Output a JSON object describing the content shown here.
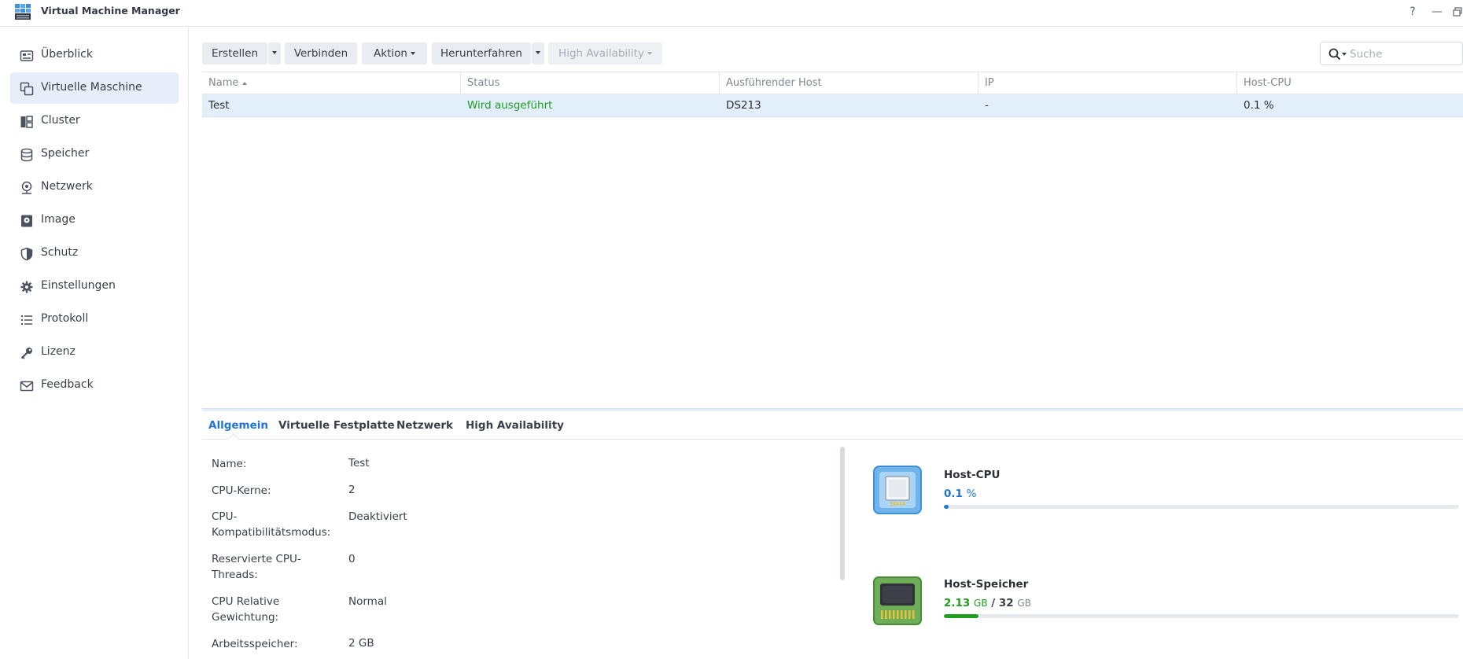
{
  "window": {
    "title": "Virtual Machine Manager",
    "help_label": "?",
    "minimize_label": "—"
  },
  "sidebar": {
    "items": [
      {
        "label": "Überblick",
        "icon": "overview-icon"
      },
      {
        "label": "Virtuelle Maschine",
        "icon": "virtual-machine-icon",
        "active": true
      },
      {
        "label": "Cluster",
        "icon": "cluster-icon"
      },
      {
        "label": "Speicher",
        "icon": "storage-icon"
      },
      {
        "label": "Netzwerk",
        "icon": "network-icon"
      },
      {
        "label": "Image",
        "icon": "image-icon"
      },
      {
        "label": "Schutz",
        "icon": "shield-icon"
      },
      {
        "label": "Einstellungen",
        "icon": "gear-icon"
      },
      {
        "label": "Protokoll",
        "icon": "log-list-icon"
      },
      {
        "label": "Lizenz",
        "icon": "key-icon"
      },
      {
        "label": "Feedback",
        "icon": "mail-icon"
      }
    ]
  },
  "toolbar": {
    "create_label": "Erstellen",
    "connect_label": "Verbinden",
    "action_label": "Aktion",
    "shutdown_label": "Herunterfahren",
    "ha_label": "High Availability",
    "search_placeholder": "Suche"
  },
  "grid": {
    "columns": [
      "Name",
      "Status",
      "Ausführender Host",
      "IP",
      "Host-CPU"
    ],
    "sort_column": "Name",
    "rows": [
      {
        "name": "Test",
        "status": "Wird ausgeführt",
        "host": "DS213",
        "ip": "-",
        "cpu": "0.1 %"
      }
    ]
  },
  "detail": {
    "tabs": [
      "Allgemein",
      "Virtuelle Festplatte",
      "Netzwerk",
      "High Availability"
    ],
    "active_tab": "Allgemein",
    "properties": [
      {
        "label": "Name:",
        "value": "Test"
      },
      {
        "label": "CPU-Kerne:",
        "value": "2"
      },
      {
        "label": "CPU-Kompatibilitätsmodus:",
        "label_lines": [
          "CPU-",
          "Kompatibilitätsmodus:"
        ],
        "value": "Deaktiviert"
      },
      {
        "label": "Reservierte CPU-Threads:",
        "label_lines": [
          "Reservierte CPU-",
          "Threads:"
        ],
        "value": "0"
      },
      {
        "label": "CPU Relative Gewichtung:",
        "label_lines": [
          "CPU Relative",
          "Gewichtung:"
        ],
        "value": "Normal"
      },
      {
        "label": "Arbeitsspeicher:",
        "value": "2 GB"
      }
    ]
  },
  "stats": {
    "cpu": {
      "title": "Host-CPU",
      "value": "0.1",
      "unit": "%",
      "fraction": 0.001,
      "color": "#1f74d6"
    },
    "memory": {
      "title": "Host-Speicher",
      "used": "2.13",
      "used_unit": "GB",
      "separator": "/",
      "total": "32",
      "total_unit": "GB",
      "fraction": 0.0666,
      "color": "#1f9e1f"
    }
  }
}
